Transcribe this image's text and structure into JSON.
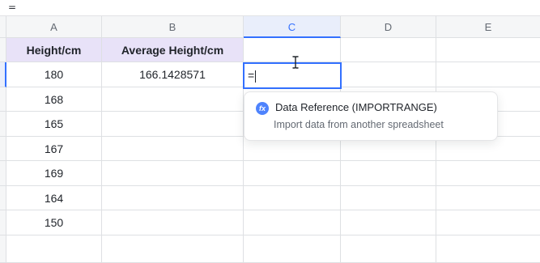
{
  "formula_bar": {
    "content": "="
  },
  "columns": [
    {
      "letter": "A"
    },
    {
      "letter": "B"
    },
    {
      "letter": "C"
    },
    {
      "letter": "D"
    },
    {
      "letter": "E"
    }
  ],
  "cells": {
    "A1": "Height/cm",
    "B1": "Average Height/cm",
    "A2": "180",
    "B2": "166.1428571",
    "A3": "168",
    "A4": "165",
    "A5": "167",
    "A6": "169",
    "A7": "164",
    "A8": "150"
  },
  "active_cell": {
    "column": "C",
    "editor_value": "="
  },
  "suggestion": {
    "title": "Data Reference (IMPORTRANGE)",
    "description": "Import data from another spreadsheet",
    "icon": "fx-icon",
    "icon_label": "fx",
    "icon_color": "#4e83fd"
  },
  "colors": {
    "accent": "#3370ff",
    "header_fill": "#e8e2f8"
  }
}
